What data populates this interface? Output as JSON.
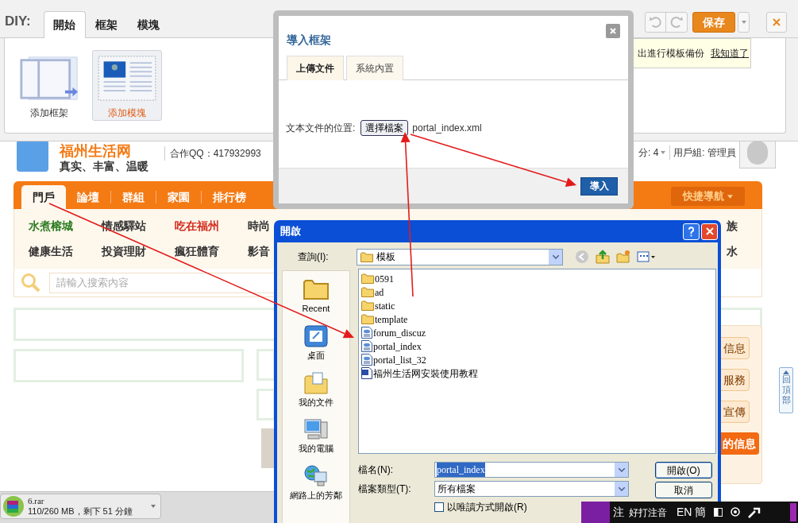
{
  "diy_toolbar": {
    "label": "DIY:",
    "tabs": [
      {
        "label": "開始",
        "selected": true
      },
      {
        "label": "框架",
        "selected": false
      },
      {
        "label": "模塊",
        "selected": false
      }
    ],
    "tools": [
      {
        "label": "添加框架",
        "kind": "frame",
        "selected": false
      },
      {
        "label": "添加模塊",
        "kind": "module",
        "selected": true
      }
    ],
    "save_button": "保存",
    "tip": {
      "text": "出進行模板備份",
      "link": "我知道了"
    }
  },
  "site": {
    "logo_title": "福州生活网",
    "logo_tagline": "真实、丰富、温暖",
    "partner_qq": "合作QQ：417932993",
    "points": "分: 4",
    "user_group": "用戶組: 管理員",
    "quick_nav": "快捷導航",
    "nav": [
      {
        "label": "門戶",
        "selected": true
      },
      {
        "label": "論壇",
        "selected": false
      },
      {
        "label": "群組",
        "selected": false
      },
      {
        "label": "家園",
        "selected": false
      },
      {
        "label": "排行榜",
        "selected": false
      }
    ],
    "sublink_rows": [
      [
        {
          "label": "水煮榕城",
          "color": "#2a7a1e"
        },
        {
          "label": "情感驛站",
          "color": "#333333"
        },
        {
          "label": "吃在福州",
          "color": "#d32a1c"
        },
        {
          "label": "時尚",
          "color": "#333333"
        },
        {
          "label": "族",
          "color": "#333333"
        }
      ],
      [
        {
          "label": "健康生活",
          "color": "#333333"
        },
        {
          "label": "投資理財",
          "color": "#333333"
        },
        {
          "label": "瘋狂體育",
          "color": "#333333"
        },
        {
          "label": "影音",
          "color": "#333333"
        },
        {
          "label": "水",
          "color": "#333333"
        }
      ]
    ],
    "search_placeholder": "請輸入搜索內容",
    "side_buttons": [
      {
        "label": "信息",
        "kind": "plain"
      },
      {
        "label": "服務",
        "kind": "plain"
      },
      {
        "label": "宣傳",
        "kind": "plain"
      },
      {
        "label": "的信息",
        "kind": "highlight"
      }
    ],
    "back_to_top": "回頂部"
  },
  "import_dialog": {
    "title": "導入框架",
    "tabs": [
      {
        "label": "上傳文件",
        "selected": true
      },
      {
        "label": "系統內置",
        "selected": false
      }
    ],
    "file_label": "文本文件的位置:",
    "choose_button": "選擇檔案",
    "file_name": "portal_index.xml",
    "import_button": "導入"
  },
  "open_dialog": {
    "title": "開啟",
    "look_in_label": "查詢(I):",
    "look_in": "模板",
    "places": [
      {
        "label": "Recent",
        "kind": "recent"
      },
      {
        "label": "桌面",
        "kind": "desktop"
      },
      {
        "label": "我的文件",
        "kind": "documents"
      },
      {
        "label": "我的電腦",
        "kind": "computer"
      },
      {
        "label": "網路上的芳鄰",
        "kind": "network"
      }
    ],
    "files": [
      {
        "name": "0591",
        "kind": "folder"
      },
      {
        "name": "ad",
        "kind": "folder"
      },
      {
        "name": "static",
        "kind": "folder"
      },
      {
        "name": "template",
        "kind": "folder"
      },
      {
        "name": "forum_discuz",
        "kind": "xml"
      },
      {
        "name": "portal_index",
        "kind": "xml"
      },
      {
        "name": "portal_list_32",
        "kind": "xml"
      },
      {
        "name": "福州生活网安裝使用教程",
        "kind": "doc"
      }
    ],
    "file_name_label": "檔名(N):",
    "file_name": {
      "value": "portal_index",
      "highlighted": true
    },
    "file_type_label": "檔案類型(T):",
    "file_type": "所有檔案",
    "open_button": "開啟(O)",
    "cancel_button": "取消",
    "readonly": {
      "label": "以唯讀方式開啟(R)",
      "checked": false
    }
  },
  "download": {
    "name": "6.rar",
    "status": "110/260 MB，剩下 51 分鐘"
  },
  "ime": {
    "mode": "注",
    "method": "好打注音",
    "lang": "EN",
    "script": "簡"
  }
}
